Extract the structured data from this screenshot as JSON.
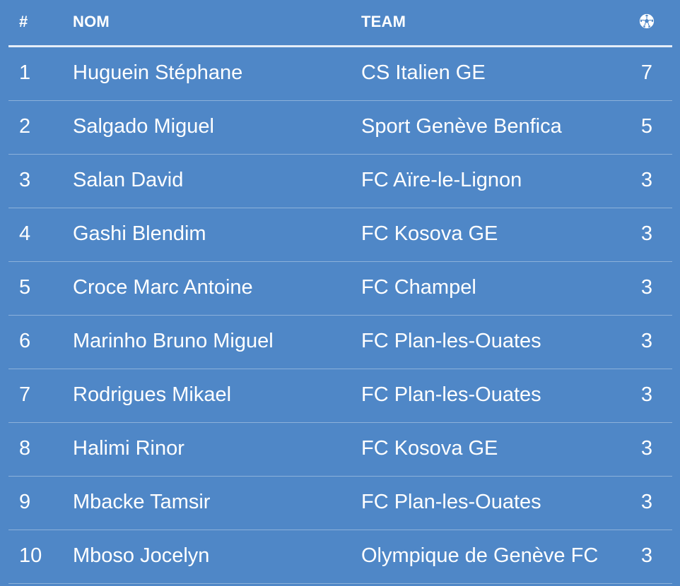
{
  "header": {
    "rank": "#",
    "name": "NOM",
    "team": "TEAM",
    "goals_icon": "soccer-ball-icon"
  },
  "rows": [
    {
      "rank": "1",
      "name": "Huguein Stéphane",
      "team": "CS Italien GE",
      "goals": "7"
    },
    {
      "rank": "2",
      "name": "Salgado Miguel",
      "team": "Sport Genève Benfica",
      "goals": "5"
    },
    {
      "rank": "3",
      "name": "Salan David",
      "team": "FC Aïre-le-Lignon",
      "goals": "3"
    },
    {
      "rank": "4",
      "name": "Gashi Blendim",
      "team": "FC Kosova GE",
      "goals": "3"
    },
    {
      "rank": "5",
      "name": "Croce Marc Antoine",
      "team": "FC Champel",
      "goals": "3"
    },
    {
      "rank": "6",
      "name": "Marinho Bruno Miguel",
      "team": "FC Plan-les-Ouates",
      "goals": "3"
    },
    {
      "rank": "7",
      "name": "Rodrigues Mikael",
      "team": "FC Plan-les-Ouates",
      "goals": "3"
    },
    {
      "rank": "8",
      "name": "Halimi Rinor",
      "team": "FC Kosova GE",
      "goals": "3"
    },
    {
      "rank": "9",
      "name": "Mbacke Tamsir",
      "team": "FC Plan-les-Ouates",
      "goals": "3"
    },
    {
      "rank": "10",
      "name": "Mboso Jocelyn",
      "team": "Olympique de Genève FC",
      "goals": "3"
    }
  ],
  "colors": {
    "background": "#4f87c7",
    "text": "#ffffff"
  }
}
